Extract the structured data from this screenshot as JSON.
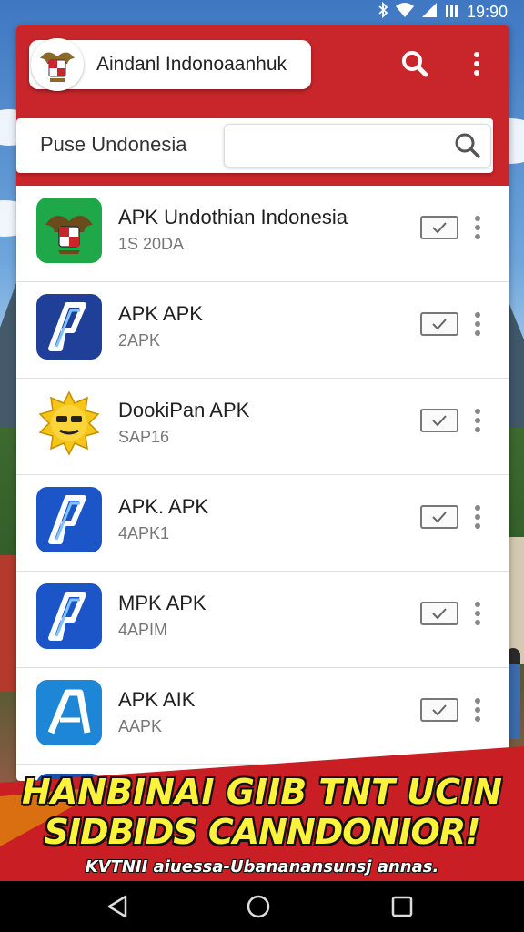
{
  "status_bar": {
    "time": "19:90"
  },
  "header": {
    "title": "Aindanl Indonoaanhuk",
    "search_label": "Puse Undonesia",
    "search_placeholder": ""
  },
  "apps": [
    {
      "name": "APK Undothian Indonesia",
      "sub": "1S 20DA",
      "icon": "garuda-emblem-icon"
    },
    {
      "name": "APK APK",
      "sub": "2APK",
      "icon": "apk-logo-icon"
    },
    {
      "name": "DookiPan APK",
      "sub": "SAP16",
      "icon": "sun-face-icon"
    },
    {
      "name": "APK. APK",
      "sub": "4APK1",
      "icon": "apk-logo-icon"
    },
    {
      "name": "MPK APK",
      "sub": "4APIM",
      "icon": "apk-logo-icon"
    },
    {
      "name": "APK AIK",
      "sub": "AAPK",
      "icon": "apk-logo-icon"
    }
  ],
  "banner": {
    "line1": "HANBINAI GIIB TNT UCIN",
    "line2": "SIDBIDS CANNDONIOR!",
    "line3": "KVTNII aiuessa-Ubananansunsj annas."
  },
  "colors": {
    "header_red": "#c8262a",
    "banner_yellow": "#fff23a",
    "apk_blue": "#1a4fb0"
  }
}
